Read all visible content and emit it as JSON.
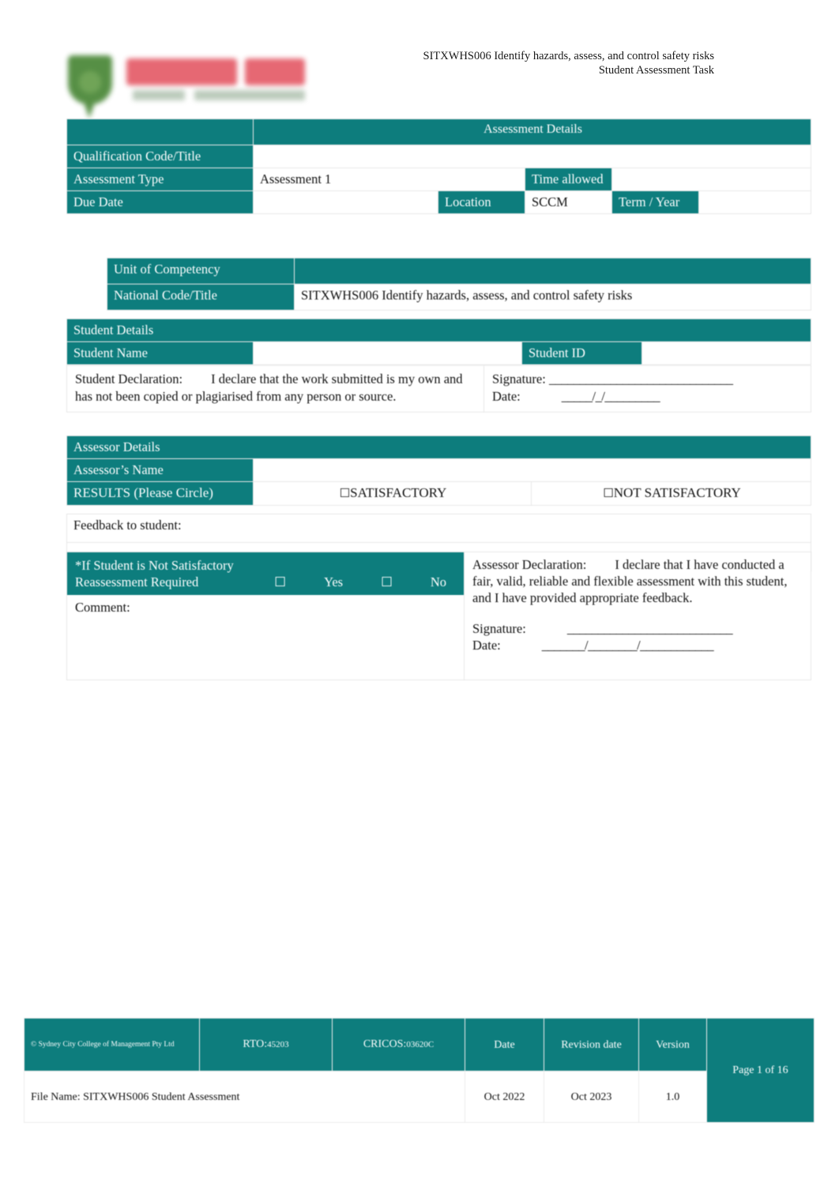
{
  "header": {
    "unit_title": "SITXWHS006 Identify hazards, assess, and control safety risks",
    "doc_type": "Student Assessment Task",
    "logo_name": "sydney-city-college-of-management-logo"
  },
  "assessment_details": {
    "section_title": "Assessment Details",
    "qualification_label": "Qualification Code/Title",
    "qualification_value": "",
    "assessment_type_label": "Assessment Type",
    "assessment_type_value": "Assessment 1",
    "time_allowed_label": "Time allowed",
    "time_allowed_value": "",
    "due_date_label": "Due Date",
    "due_date_value": "",
    "location_label": "Location",
    "location_value": "SCCM",
    "term_year_label": "Term / Year",
    "term_year_value": ""
  },
  "unit_of_competency": {
    "title_label": "Unit of Competency",
    "national_code_label": "National Code/Title",
    "national_code_value": "SITXWHS006 Identify hazards, assess, and control safety risks"
  },
  "student_details": {
    "section_title": "Student Details",
    "student_name_label": "Student Name",
    "student_name_value": "",
    "student_id_label": "Student ID",
    "student_id_value": ""
  },
  "student_declaration": {
    "label": "Student Declaration:",
    "text": "I declare that the work submitted is my own and has not been copied or plagiarised from any person or source.",
    "signature_label": "Signature:",
    "signature_line": "______________________________",
    "date_label": "Date:",
    "date_line": "_____/_/_________"
  },
  "assessor_details": {
    "section_title": "Assessor Details",
    "assessor_name_label": "Assessor’s Name",
    "assessor_name_value": "",
    "results_label": "RESULTS (Please Circle)",
    "result_satisfactory": "SATISFACTORY",
    "result_not_satisfactory": "NOT SATISFACTORY",
    "checkbox_glyph": "☐"
  },
  "feedback": {
    "label": "Feedback to student:",
    "value": ""
  },
  "reassessment": {
    "heading": "*If Student is Not Satisfactory",
    "required_label": "Reassessment Required",
    "yes_label": "Yes",
    "no_label": "No",
    "checkbox_glyph": "☐",
    "comment_label": "Comment:",
    "comment_value": ""
  },
  "assessor_declaration": {
    "label": "Assessor Declaration:",
    "text": "I declare that I have conducted a fair, valid, reliable and flexible assessment with this student, and I have provided appropriate feedback.",
    "signature_label": "Signature:",
    "signature_line": "___________________________",
    "date_label": "Date:",
    "date_line": "_______/________/____________"
  },
  "footer": {
    "copyright": "© Sydney City College of Management Pty Ltd",
    "rto_label": "RTO:",
    "rto_value": "45203",
    "cricos_label": "CRICOS:",
    "cricos_value": "03620C",
    "date_header": "Date",
    "revision_header": "Revision date",
    "version_header": "Version",
    "file_name": "File Name: SITXWHS006 Student Assessment",
    "date_value": "Oct 2022",
    "revision_value": "Oct 2023",
    "version_value": "1.0",
    "page_indicator": "Page 1 of 16"
  },
  "colors": {
    "teal": "#0d7d7d",
    "logo_green": "#4e8a3c",
    "logo_red": "#e5606c"
  }
}
